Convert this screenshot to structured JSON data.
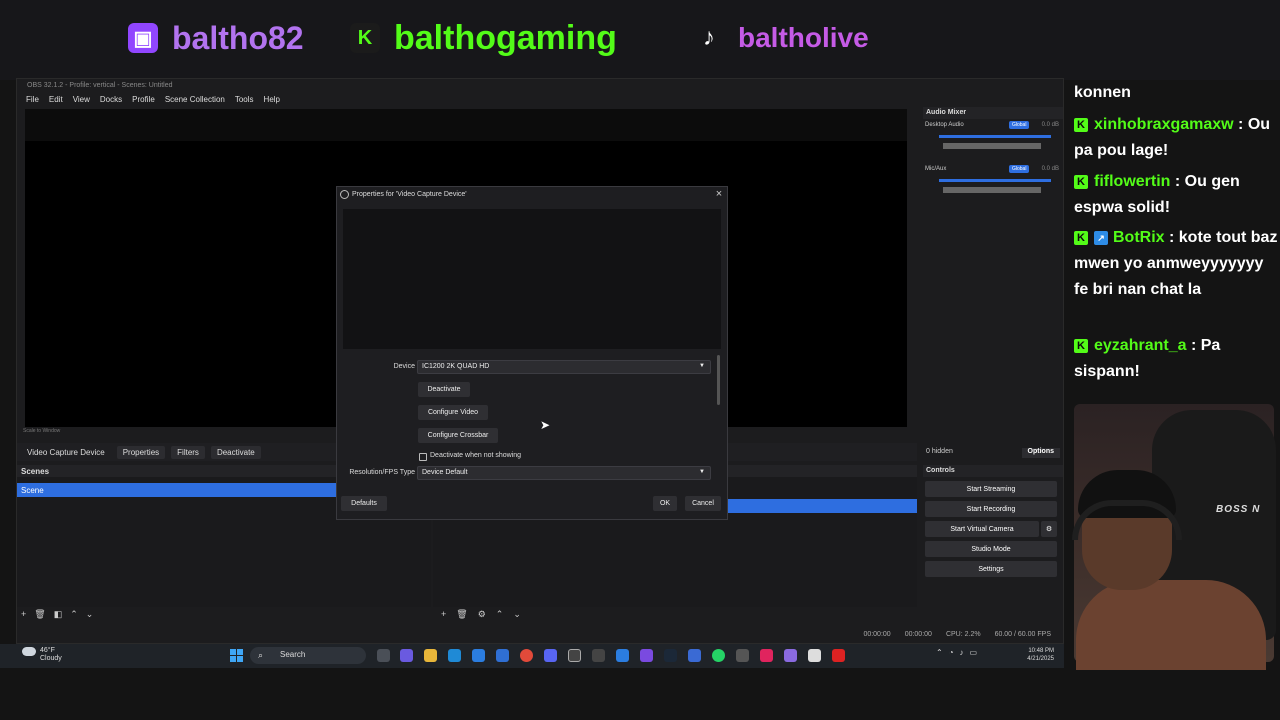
{
  "banner": {
    "twitch": "baltho82",
    "kick": "balthogaming",
    "tiktok": "baltholive",
    "colors": {
      "twitch": "#9146ff",
      "kick": "#53fc18",
      "tiktok": "#c55be6"
    }
  },
  "obs": {
    "title": "OBS 32.1.2 - Profile: vertical - Scenes: Untitled",
    "menu": [
      "File",
      "Edit",
      "View",
      "Docks",
      "Profile",
      "Scene Collection",
      "Tools",
      "Help"
    ],
    "scale_label": "Scale to Window",
    "source_name": "Video Capture Device",
    "properties_label": "Properties",
    "filters_label": "Filters",
    "deactivate_label": "Deactivate",
    "scenes_header": "Scenes",
    "scene_item": "Scene",
    "mixer": {
      "header": "Audio Mixer",
      "channels": [
        {
          "name": "Desktop Audio",
          "tag": "Global",
          "db": "0.0 dB"
        },
        {
          "name": "Mic/Aux",
          "tag": "Global",
          "db": "0.0 dB"
        }
      ],
      "hidden": "0 hidden",
      "options": "Options"
    },
    "controls": {
      "header": "Controls",
      "start_streaming": "Start Streaming",
      "start_recording": "Start Recording",
      "start_virtual_camera": "Start Virtual Camera",
      "studio_mode": "Studio Mode",
      "settings": "Settings"
    },
    "status": {
      "stream_time": "00:00:00",
      "rec_time": "00:00:00",
      "cpu": "CPU: 2.2%",
      "fps": "60.00 / 60.00 FPS"
    }
  },
  "dialog": {
    "title": "Properties for 'Video Capture Device'",
    "device_label": "Device",
    "device_value": "IC1200 2K QUAD HD",
    "deactivate": "Deactivate",
    "configure_video": "Configure Video",
    "configure_crossbar": "Configure Crossbar",
    "deactivate_when_not_showing": "Deactivate when not showing",
    "resolution_label": "Resolution/FPS Type",
    "resolution_value": "Device Default",
    "defaults": "Defaults",
    "ok": "OK",
    "cancel": "Cancel"
  },
  "chat": {
    "messages": [
      {
        "user": "",
        "text": "konnen"
      },
      {
        "user": "xinhobraxgamaxw",
        "text": "Ou pa pou lage!"
      },
      {
        "user": "fiflowertin",
        "text": "Ou gen espwa solid!"
      },
      {
        "user": "BotRix",
        "text": "kote tout baz mwen yo anmweyyyyyyy fe bri nan chat la"
      },
      {
        "user": "eyzahrant_a",
        "text": "Pa sispann!"
      }
    ]
  },
  "webcam": {
    "chair_text": "BOSS N"
  },
  "taskbar": {
    "temp": "46°F",
    "weather": "Cloudy",
    "search": "Search",
    "time": "10:48 PM",
    "date": "4/21/2025"
  }
}
